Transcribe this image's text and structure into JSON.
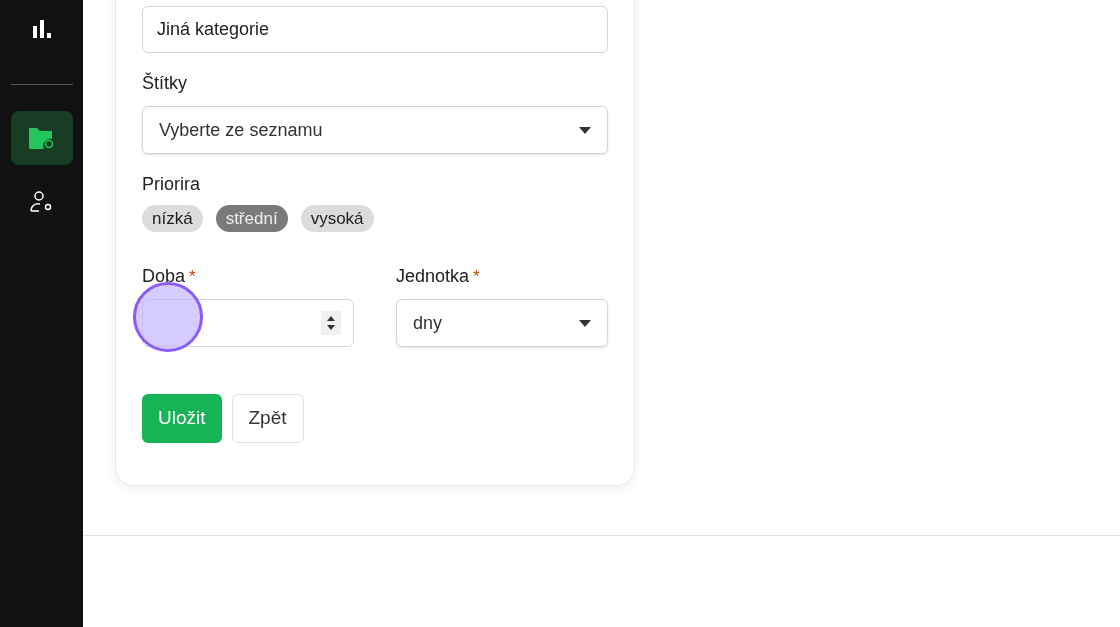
{
  "sidebar": {
    "items": [
      {
        "kind": "folder",
        "selected": true
      },
      {
        "kind": "user-settings",
        "selected": false
      }
    ]
  },
  "form": {
    "category": {
      "value": "Jiná kategorie"
    },
    "tags": {
      "label": "Štítky",
      "value": "Vyberte ze seznamu"
    },
    "priority": {
      "label": "Priorira",
      "options": [
        {
          "label": "nízká",
          "selected": false
        },
        {
          "label": "střední",
          "selected": true
        },
        {
          "label": "vysoká",
          "selected": false
        }
      ]
    },
    "duration": {
      "label": "Doba",
      "required": true,
      "required_mark": "*"
    },
    "unit": {
      "label": "Jednotka",
      "required": true,
      "required_mark": "*",
      "value": "dny"
    },
    "buttons": [
      {
        "label": "Uložit",
        "kind": "primary"
      },
      {
        "label": "Zpět",
        "kind": "secondary"
      }
    ]
  }
}
